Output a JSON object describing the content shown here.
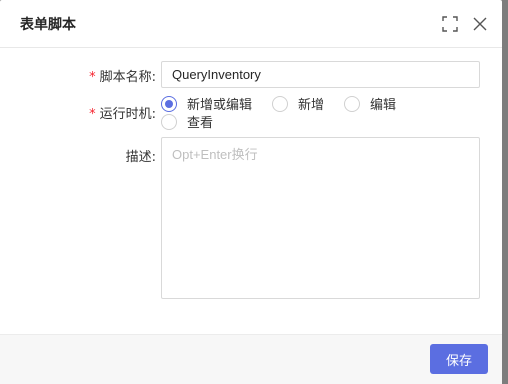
{
  "dialog": {
    "title": "表单脚本",
    "fullscreen_icon": "fullscreen-icon",
    "close_icon": "close-icon"
  },
  "form": {
    "name_label": "脚本名称:",
    "name_value": "QueryInventory",
    "timing_label": "运行时机:",
    "timing_options": [
      {
        "label": "新增或编辑",
        "checked": true
      },
      {
        "label": "新增",
        "checked": false
      },
      {
        "label": "编辑",
        "checked": false
      },
      {
        "label": "查看",
        "checked": false
      }
    ],
    "desc_label": "描述:",
    "desc_placeholder": "Opt+Enter换行",
    "required_mark": "*"
  },
  "footer": {
    "save_label": "保存"
  },
  "colors": {
    "accent": "#5b6ee1",
    "required": "#f5222d"
  }
}
